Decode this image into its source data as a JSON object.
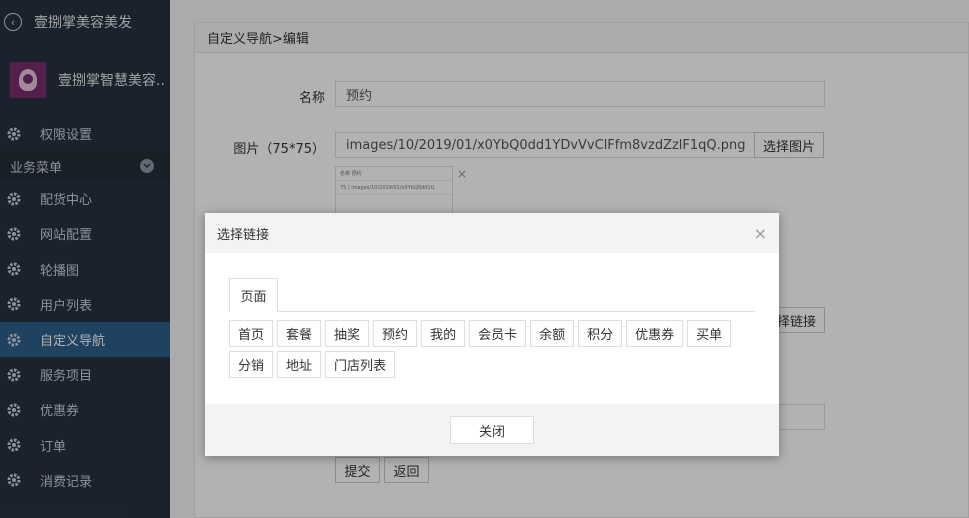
{
  "sidebar": {
    "app_title": "壹捌掌美容美发",
    "profile_name": "壹捌掌智慧美容...",
    "top_item": "权限设置",
    "section_label": "业务菜单",
    "items": [
      {
        "label": "配货中心"
      },
      {
        "label": "网站配置"
      },
      {
        "label": "轮播图"
      },
      {
        "label": "用户列表"
      },
      {
        "label": "自定义导航"
      },
      {
        "label": "服务项目"
      },
      {
        "label": "优惠券"
      },
      {
        "label": "订单"
      },
      {
        "label": "消费记录"
      }
    ],
    "active_color": "#2d5f8c"
  },
  "main": {
    "breadcrumb": "自定义导航>编辑",
    "name_label": "名称",
    "name_value": "预约",
    "image_label": "图片（75*75）",
    "image_value": "images/10/2019/01/x0YbQ0dd1YDvVvClFfm8vzdZzlF1qQ.png",
    "choose_image_button": "选择图片",
    "thumb_rows": [
      "名称   预约",
      "75 |   images/10/2019/01/x0YbQ0dd1Q"
    ],
    "choose_link_button_partial": "择链接",
    "submit_button": "提交",
    "back_button": "返回"
  },
  "modal": {
    "title": "选择链接",
    "tab_label": "页面",
    "links": [
      "首页",
      "套餐",
      "抽奖",
      "预约",
      "我的",
      "会员卡",
      "余额",
      "积分",
      "优惠券",
      "买单",
      "分销",
      "地址",
      "门店列表"
    ],
    "close_button": "关闭"
  }
}
